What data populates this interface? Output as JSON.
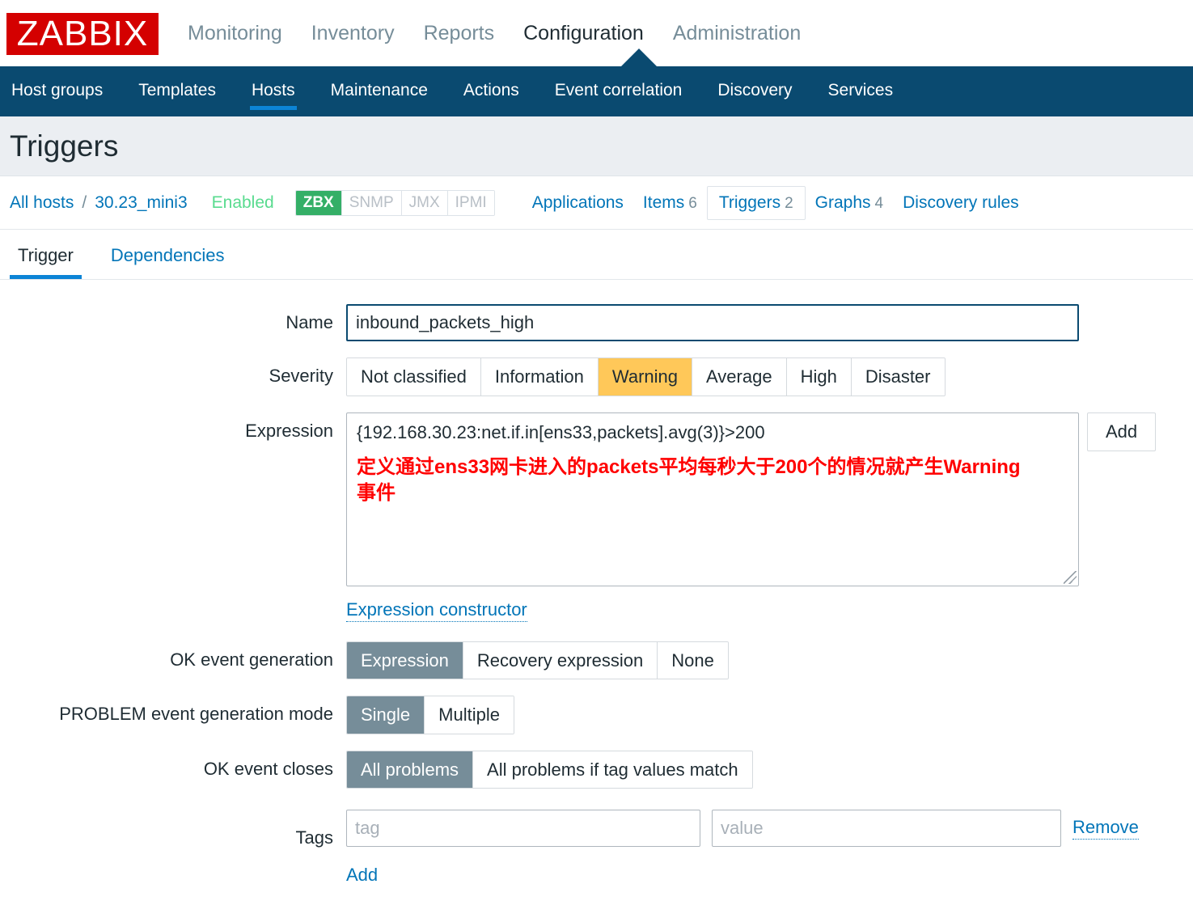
{
  "brand": {
    "logo_text": "ZABBIX",
    "logo_bg": "#d40000"
  },
  "main_nav": {
    "items": [
      {
        "label": "Monitoring",
        "selected": false
      },
      {
        "label": "Inventory",
        "selected": false
      },
      {
        "label": "Reports",
        "selected": false
      },
      {
        "label": "Configuration",
        "selected": true
      },
      {
        "label": "Administration",
        "selected": false
      }
    ]
  },
  "sub_nav": {
    "items": [
      {
        "label": "Host groups",
        "selected": false
      },
      {
        "label": "Templates",
        "selected": false
      },
      {
        "label": "Hosts",
        "selected": true
      },
      {
        "label": "Maintenance",
        "selected": false
      },
      {
        "label": "Actions",
        "selected": false
      },
      {
        "label": "Event correlation",
        "selected": false
      },
      {
        "label": "Discovery",
        "selected": false
      },
      {
        "label": "Services",
        "selected": false
      }
    ]
  },
  "page": {
    "title": "Triggers"
  },
  "host_bar": {
    "all_hosts": "All hosts",
    "separator": "/",
    "host_name": "30.23_mini3",
    "status": "Enabled",
    "status_color": "#59db8f",
    "protocols": [
      {
        "label": "ZBX",
        "active": true
      },
      {
        "label": "SNMP",
        "active": false
      },
      {
        "label": "JMX",
        "active": false
      },
      {
        "label": "IPMI",
        "active": false
      }
    ],
    "links": [
      {
        "label": "Applications",
        "count": "",
        "selected": false
      },
      {
        "label": "Items",
        "count": "6",
        "selected": false
      },
      {
        "label": "Triggers",
        "count": "2",
        "selected": true
      },
      {
        "label": "Graphs",
        "count": "4",
        "selected": false
      },
      {
        "label": "Discovery rules",
        "count": "",
        "selected": false
      }
    ]
  },
  "tabs": [
    {
      "label": "Trigger",
      "selected": true
    },
    {
      "label": "Dependencies",
      "selected": false
    }
  ],
  "form": {
    "name": {
      "label": "Name",
      "value": "inbound_packets_high",
      "placeholder": ""
    },
    "severity": {
      "label": "Severity",
      "selected": "Warning",
      "selected_color": "#ffc859",
      "options": [
        "Not classified",
        "Information",
        "Warning",
        "Average",
        "High",
        "Disaster"
      ]
    },
    "expression": {
      "label": "Expression",
      "value": "{192.168.30.23:net.if.in[ens33,packets].avg(3)}>200",
      "annotation": "定义通过ens33网卡进入的packets平均每秒大于200个的情况就产生Warning事件",
      "annotation_color": "#ff0000",
      "add_button": "Add",
      "constructor_link": "Expression constructor"
    },
    "ok_event_generation": {
      "label": "OK event generation",
      "selected": "Expression",
      "options": [
        "Expression",
        "Recovery expression",
        "None"
      ]
    },
    "problem_event_generation_mode": {
      "label": "PROBLEM event generation mode",
      "selected": "Single",
      "options": [
        "Single",
        "Multiple"
      ]
    },
    "ok_event_closes": {
      "label": "OK event closes",
      "selected": "All problems",
      "options": [
        "All problems",
        "All problems if tag values match"
      ]
    },
    "tags": {
      "label": "Tags",
      "tag_placeholder": "tag",
      "tag_value": "",
      "value_placeholder": "value",
      "value_value": "",
      "remove_label": "Remove",
      "add_label": "Add"
    }
  }
}
